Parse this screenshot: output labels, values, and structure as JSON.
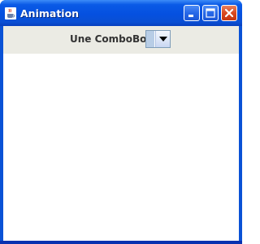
{
  "window": {
    "title": "Animation",
    "accent_color": "#0a52d6",
    "icons": {
      "app": "java-cup-icon",
      "minimize": "minimize-icon",
      "maximize": "maximize-icon",
      "close": "close-icon"
    }
  },
  "toolbar": {
    "combo_label": "Une ComboBox",
    "combo_selected_value": ""
  },
  "colors": {
    "panel_background": "#ebebe4",
    "content_background": "#ffffff",
    "close_button": "#d9481f"
  }
}
